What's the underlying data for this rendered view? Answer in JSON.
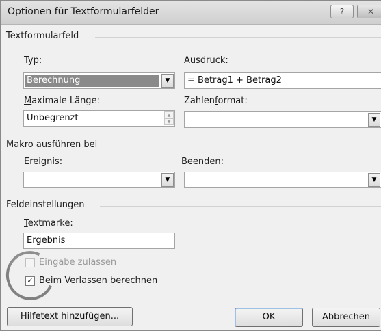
{
  "window": {
    "title": "Optionen für Textformularfelder",
    "help_icon": "?",
    "close_icon": "✕"
  },
  "textformfield": {
    "group_label": "Textformularfeld",
    "typ_label_pre": "Ty",
    "typ_label_u": "p",
    "typ_label_post": ":",
    "typ_value": "Berechnung",
    "ausdruck_label_pre": "",
    "ausdruck_label_u": "A",
    "ausdruck_label_post": "usdruck:",
    "ausdruck_value": "= Betrag1 + Betrag2",
    "maxlen_label_pre": "",
    "maxlen_label_u": "M",
    "maxlen_label_post": "aximale Länge:",
    "maxlen_value": "Unbegrenzt",
    "format_label_pre": "Zahlen",
    "format_label_u": "f",
    "format_label_post": "ormat:",
    "format_value": ""
  },
  "macro": {
    "group_label": "Makro ausführen bei",
    "ereignis_label_pre": "",
    "ereignis_label_u": "E",
    "ereignis_label_post": "reignis:",
    "ereignis_value": "",
    "beenden_label_pre": "Bee",
    "beenden_label_u": "n",
    "beenden_label_post": "den:",
    "beenden_value": ""
  },
  "settings": {
    "group_label": "Feldeinstellungen",
    "textmarke_label_pre": "",
    "textmarke_label_u": "T",
    "textmarke_label_post": "extmarke:",
    "textmarke_value": "Ergebnis",
    "eingabe_label": "Eingabe zulassen",
    "eingabe_checked": false,
    "verlassen_label_pre": "B",
    "verlassen_label_u": "e",
    "verlassen_label_post": "im Verlassen berechnen",
    "verlassen_checked": true,
    "check_glyph": "✓"
  },
  "buttons": {
    "help_text": "Hilfetext hinzufügen...",
    "ok": "OK",
    "cancel": "Abbrechen"
  },
  "icons": {
    "dropdown": "▼",
    "spin_up": "▲",
    "spin_down": "▼"
  }
}
